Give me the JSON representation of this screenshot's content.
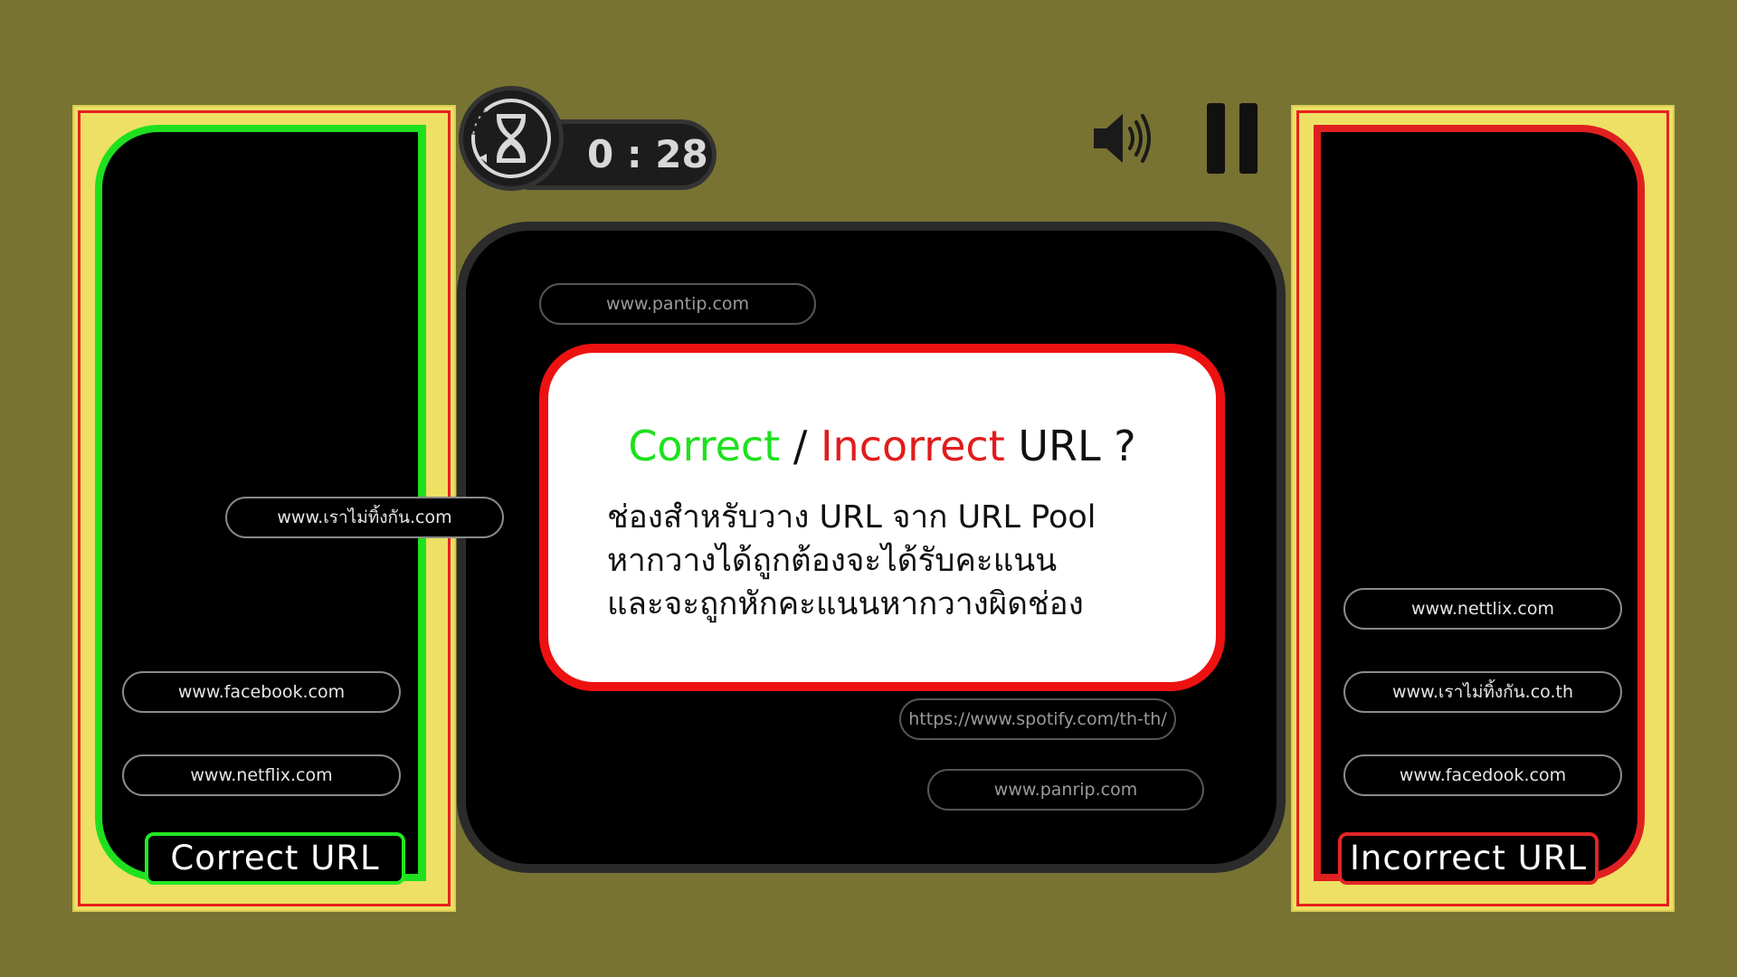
{
  "timer": {
    "display": "0 : 28"
  },
  "icons": {
    "timer": "hourglass-icon",
    "sound": "speaker-volume-icon",
    "pause": "pause-icon"
  },
  "colors": {
    "background": "#787333",
    "correct": "#1ee01e",
    "incorrect": "#e01c1c",
    "frame": "#ede064"
  },
  "bins": {
    "correct": {
      "label": "Correct URL",
      "items": [
        "www.facebook.com",
        "www.netflix.com"
      ]
    },
    "incorrect": {
      "label": "Incorrect URL",
      "items": [
        "www.nettlix.com",
        "www.เราไม่ทิ้งกัน.co.th",
        "www.facedook.com"
      ]
    }
  },
  "dragging": {
    "url": "www.เราไม่ทิ้งกัน.com"
  },
  "pool": {
    "items": [
      "www.pantip.com",
      "https://www.spotify.com/th-th/",
      "www.panrip.com"
    ]
  },
  "card": {
    "title_correct": "Correct",
    "title_slash": " / ",
    "title_incorrect": "Incorrect",
    "title_rest": " URL ?",
    "lines": [
      "ช่องสำหรับวาง URL จาก URL Pool",
      "หากวางได้ถูกต้องจะได้รับคะแนน",
      "และจะถูกหักคะแนนหากวางผิดช่อง"
    ]
  }
}
